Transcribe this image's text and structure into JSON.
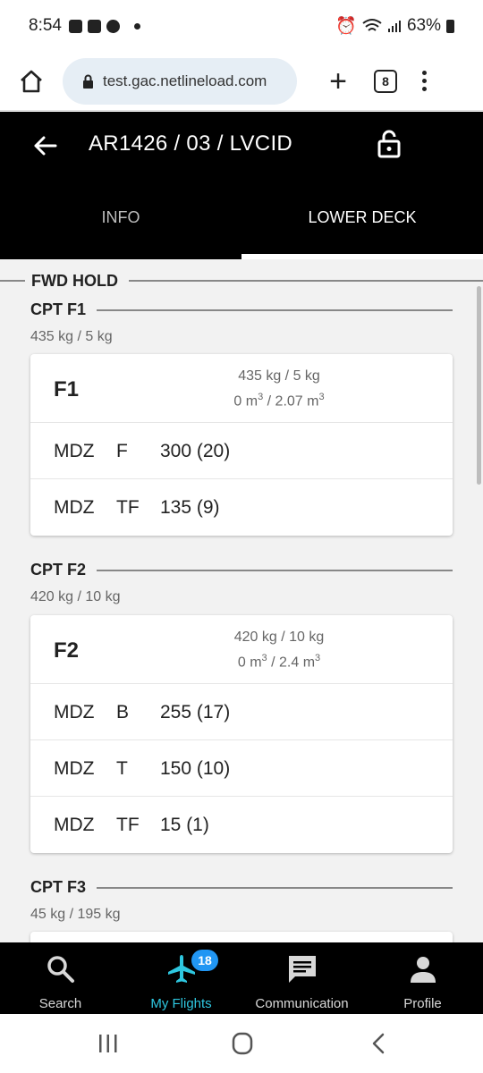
{
  "status_bar": {
    "time": "8:54",
    "battery": "63%"
  },
  "browser": {
    "url": "test.gac.netlineload.com",
    "tab_count": "8",
    "new_tab": "+"
  },
  "header": {
    "title": "AR1426 / 03 / LVCID",
    "tabs": [
      {
        "label": "INFO"
      },
      {
        "label": "LOWER DECK"
      }
    ],
    "active_tab": "LOWER DECK"
  },
  "hold": {
    "label": "FWD HOLD"
  },
  "compartments": [
    {
      "label": "CPT F1",
      "summary": "435 kg / 5 kg",
      "card": {
        "name": "F1",
        "weight": "435 kg / 5 kg",
        "volume_used": "0 m",
        "volume_total": "2.07 m",
        "volume_sep": " / ",
        "unit_exp": "3",
        "items": [
          {
            "dest": "MDZ",
            "code": "F",
            "qty": "300 (20)"
          },
          {
            "dest": "MDZ",
            "code": "TF",
            "qty": "135 (9)"
          }
        ]
      }
    },
    {
      "label": "CPT F2",
      "summary": "420 kg / 10 kg",
      "card": {
        "name": "F2",
        "weight": "420 kg / 10 kg",
        "volume_used": "0 m",
        "volume_total": "2.4 m",
        "volume_sep": " / ",
        "unit_exp": "3",
        "items": [
          {
            "dest": "MDZ",
            "code": "B",
            "qty": "255 (17)"
          },
          {
            "dest": "MDZ",
            "code": "T",
            "qty": "150 (10)"
          },
          {
            "dest": "MDZ",
            "code": "TF",
            "qty": "15 (1)"
          }
        ]
      }
    },
    {
      "label": "CPT F3",
      "summary": "45 kg / 195 kg"
    }
  ],
  "bottom_nav": {
    "items": [
      {
        "label": "Search",
        "icon": "search-icon"
      },
      {
        "label": "My Flights",
        "icon": "airplane-icon"
      },
      {
        "label": "Communication",
        "icon": "chat-icon"
      },
      {
        "label": "Profile",
        "icon": "person-icon"
      }
    ],
    "badge": "18",
    "active_color": "#2ec7e0"
  }
}
